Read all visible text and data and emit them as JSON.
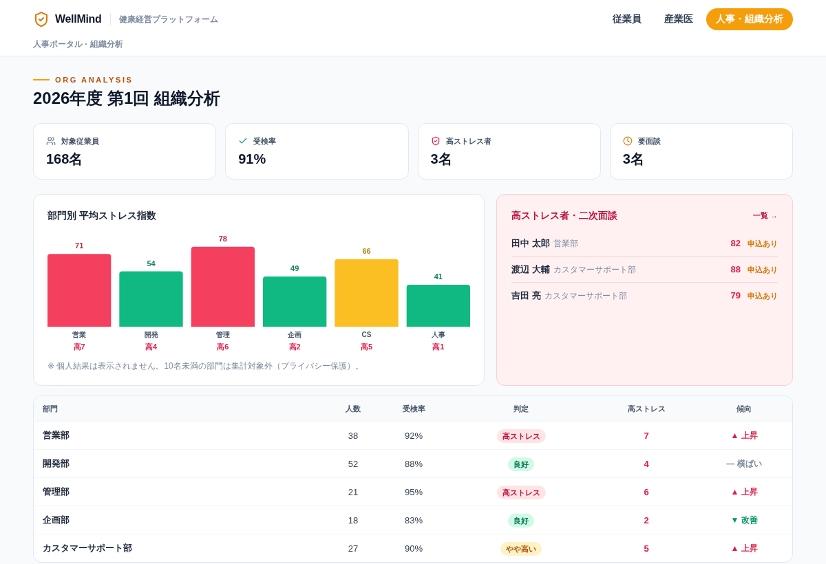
{
  "header": {
    "logo": "WellMind",
    "tagline": "健康経営プラットフォーム",
    "nav": [
      {
        "label": "従業員",
        "selected": false
      },
      {
        "label": "産業医",
        "selected": false
      },
      {
        "label": "人事・組織分析",
        "selected": true
      }
    ],
    "breadcrumb": "人事ポータル · 組織分析"
  },
  "page": {
    "eyebrow": "ORG ANALYSIS",
    "title": "2026年度 第1回 組織分析"
  },
  "stats": [
    {
      "kind": "staff",
      "label": "対象従業員",
      "value": "168名"
    },
    {
      "kind": "rate",
      "label": "受検率",
      "value": "91%"
    },
    {
      "kind": "stress",
      "label": "高ストレス者",
      "value": "3名"
    },
    {
      "kind": "interview",
      "label": "要面談",
      "value": "3名"
    }
  ],
  "stress_chart": {
    "chart_data": {
      "type": "bar",
      "title": "部門別 平均ストレス指数",
      "categories": [
        "営業",
        "開発",
        "管理",
        "企画",
        "CS",
        "人事"
      ],
      "values": [
        71,
        54,
        78,
        49,
        66,
        41
      ],
      "data_labels": true
    },
    "bars": [
      {
        "color": "#f43f5e",
        "note": "高7"
      },
      {
        "color": "#10b981",
        "note": "高4"
      },
      {
        "color": "#f43f5e",
        "note": "高6"
      },
      {
        "color": "#10b981",
        "note": "高2"
      },
      {
        "color": "#fbbf24",
        "note": "高5"
      },
      {
        "color": "#10b981",
        "note": "高1"
      }
    ],
    "note": "※ 個人結果は表示されません。10名未満の部門は集計対象外（プライバシー保護）。"
  },
  "high_stress_panel": {
    "title": "高ストレス者・二次面談",
    "link": "一覧 →",
    "people": [
      {
        "name": "田中 太郎",
        "department": "営業部",
        "score": "82",
        "status": "申込あり"
      },
      {
        "name": "渡辺 大輔",
        "department": "カスタマーサポート部",
        "score": "88",
        "status": "申込あり"
      },
      {
        "name": "吉田 亮",
        "department": "カスタマーサポート部",
        "score": "79",
        "status": "申込あり"
      }
    ]
  },
  "table": {
    "columns": [
      "部門",
      "人数",
      "受検率",
      "判定",
      "高ストレス",
      "傾向"
    ],
    "rows": [
      {
        "department": "営業部",
        "headcount": "38",
        "response_rate": "92%",
        "verdict": {
          "text": "高ストレス",
          "kind": "high"
        },
        "high_stress": "7",
        "trend": {
          "text": "▲ 上昇",
          "kind": "up"
        }
      },
      {
        "department": "開発部",
        "headcount": "52",
        "response_rate": "88%",
        "verdict": {
          "text": "良好",
          "kind": "good"
        },
        "high_stress": "4",
        "trend": {
          "text": "— 横ばい",
          "kind": "flat"
        }
      },
      {
        "department": "管理部",
        "headcount": "21",
        "response_rate": "95%",
        "verdict": {
          "text": "高ストレス",
          "kind": "high"
        },
        "high_stress": "6",
        "trend": {
          "text": "▲ 上昇",
          "kind": "up"
        }
      },
      {
        "department": "企画部",
        "headcount": "18",
        "response_rate": "83%",
        "verdict": {
          "text": "良好",
          "kind": "good"
        },
        "high_stress": "2",
        "trend": {
          "text": "▼ 改善",
          "kind": "down"
        }
      },
      {
        "department": "カスタマーサポート部",
        "headcount": "27",
        "response_rate": "90%",
        "verdict": {
          "text": "やや高い",
          "kind": "mid"
        },
        "high_stress": "5",
        "trend": {
          "text": "▲ 上昇",
          "kind": "up"
        }
      }
    ]
  }
}
